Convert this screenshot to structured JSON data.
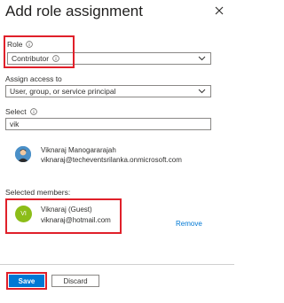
{
  "panel": {
    "title": "Add role assignment",
    "close_icon": "close-icon"
  },
  "role": {
    "label": "Role",
    "value": "Contributor"
  },
  "assign_access": {
    "label": "Assign access to",
    "value": "User, group, or service principal"
  },
  "select": {
    "label": "Select",
    "value": "vik"
  },
  "search_result": {
    "name": "Viknaraj Manogararajah",
    "email": "viknaraj@techeventsrilanka.onmicrosoft.com"
  },
  "selected_members": {
    "label": "Selected members:",
    "items": [
      {
        "initials": "VI",
        "name": "Viknaraj (Guest)",
        "email": "viknaraj@hotmail.com",
        "remove_label": "Remove"
      }
    ]
  },
  "footer": {
    "save_label": "Save",
    "discard_label": "Discard"
  },
  "colors": {
    "accent": "#0078d4",
    "highlight": "#e0202a",
    "avatar": "#8cbd18"
  }
}
